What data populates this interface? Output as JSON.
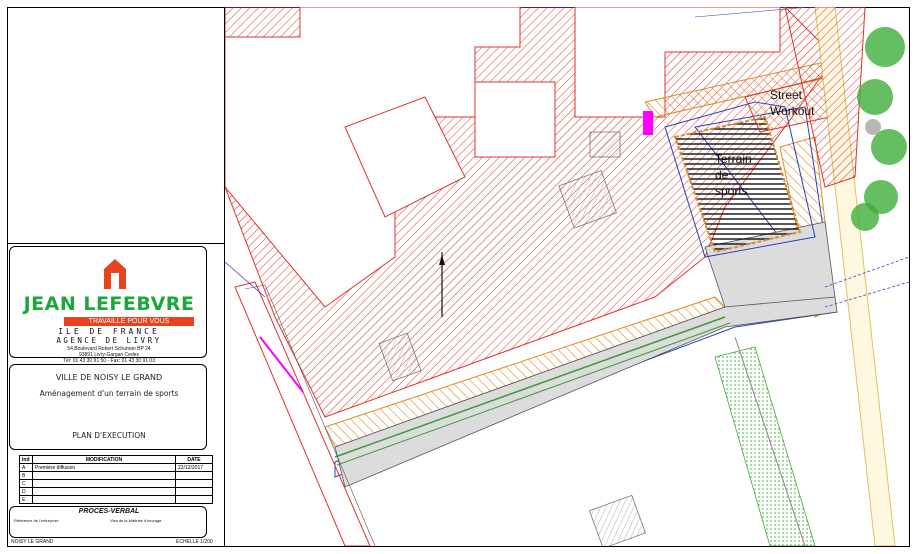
{
  "company": {
    "name": "JEAN LEFEBVRE",
    "tagline": "TRAVAILLE POUR VOUS",
    "region": "ILE DE FRANCE",
    "agency": "AGENCE DE LIVRY",
    "address": "54,Boulevard Robert Schuman BP 24",
    "city": "93891 Livry-Gargan Cedex",
    "contact": "Tél: 01 43 30 91 50 - Fax: 01 43 30 91 03",
    "brand_green": "#1aa838",
    "brand_red": "#e8421e"
  },
  "project": {
    "client": "VILLE DE NOISY LE GRAND",
    "subject": "Aménagement d'un terrain de sports",
    "phase": "PLAN D'EXECUTION"
  },
  "modifications": {
    "headers": [
      "Ind",
      "MODIFICATION",
      "DATE"
    ],
    "rows": [
      {
        "ind": "A",
        "text": "Première diffusion",
        "date": "22/12/2017"
      },
      {
        "ind": "B",
        "text": "",
        "date": ""
      },
      {
        "ind": "C",
        "text": "",
        "date": ""
      },
      {
        "ind": "D",
        "text": "",
        "date": ""
      },
      {
        "ind": "E",
        "text": "",
        "date": ""
      }
    ]
  },
  "proces_verbal": {
    "title": "PROCES-VERBAL",
    "left": "Référence de l'entreprise",
    "right": "Visa de la Maîtrise d'ouvrage"
  },
  "footer": {
    "commune": "NOISY LE GRAND",
    "scale": "ECHELLE 1/200"
  },
  "plan": {
    "label_street_1": "Street",
    "label_street_2": "Workout",
    "label_terrain_1": "Terrain",
    "label_terrain_2": "de",
    "label_terrain_3": "sports",
    "hatch_red": "#e0322a",
    "hatch_orange": "#e08a2a",
    "court_gray": "#dcdcdc",
    "tree_green": "#3fae3a"
  }
}
